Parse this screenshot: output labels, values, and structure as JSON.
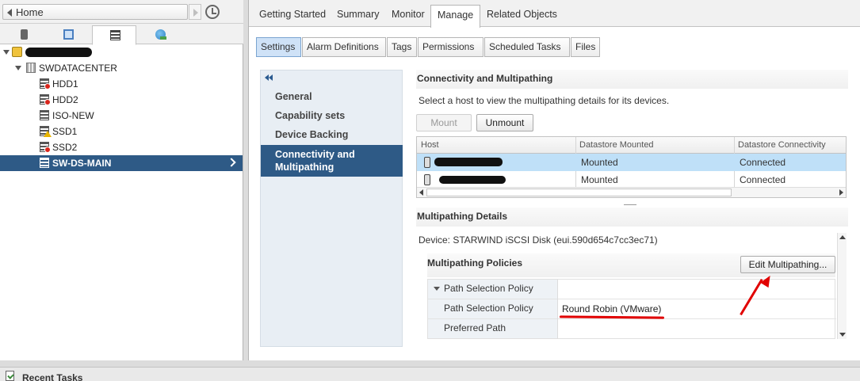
{
  "navigator": {
    "home_label": "Home",
    "tree": [
      {
        "label": "SWDATACENTER"
      },
      {
        "label": "HDD1",
        "status": "alert"
      },
      {
        "label": "HDD2",
        "status": "alert"
      },
      {
        "label": "ISO-NEW",
        "status": "none"
      },
      {
        "label": "SSD1",
        "status": "warning"
      },
      {
        "label": "SSD2",
        "status": "alert"
      },
      {
        "label": "SW-DS-MAIN",
        "status": "selected"
      }
    ]
  },
  "top_tabs": [
    "Getting Started",
    "Summary",
    "Monitor",
    "Manage",
    "Related Objects"
  ],
  "sub_tabs": [
    "Settings",
    "Alarm Definitions",
    "Tags",
    "Permissions",
    "Scheduled Tasks",
    "Files"
  ],
  "settings_menu": [
    "General",
    "Capability sets",
    "Device Backing",
    "Connectivity and Multipathing"
  ],
  "connectivity": {
    "title": "Connectivity and Multipathing",
    "instruction": "Select a host to view the multipathing details for its devices.",
    "mount_label": "Mount",
    "unmount_label": "Unmount",
    "columns": [
      "Host",
      "Datastore Mounted",
      "Datastore Connectivity"
    ],
    "rows": [
      {
        "mounted": "Mounted",
        "connectivity": "Connected"
      },
      {
        "mounted": "Mounted",
        "connectivity": "Connected"
      }
    ]
  },
  "multipathing": {
    "title": "Multipathing Details",
    "device": "Device: STARWIND iSCSI Disk (eui.590d654c7cc3ec71)",
    "policies_title": "Multipathing Policies",
    "edit_label": "Edit Multipathing...",
    "group_label": "Path Selection Policy",
    "psp_label": "Path Selection Policy",
    "psp_value": "Round Robin (VMware)",
    "preferred_label": "Preferred Path"
  },
  "recent_tasks": "Recent Tasks",
  "colors": {
    "selection": "#2e5a86",
    "annotation": "#e10000",
    "row_highlight": "#bfe0f8"
  }
}
